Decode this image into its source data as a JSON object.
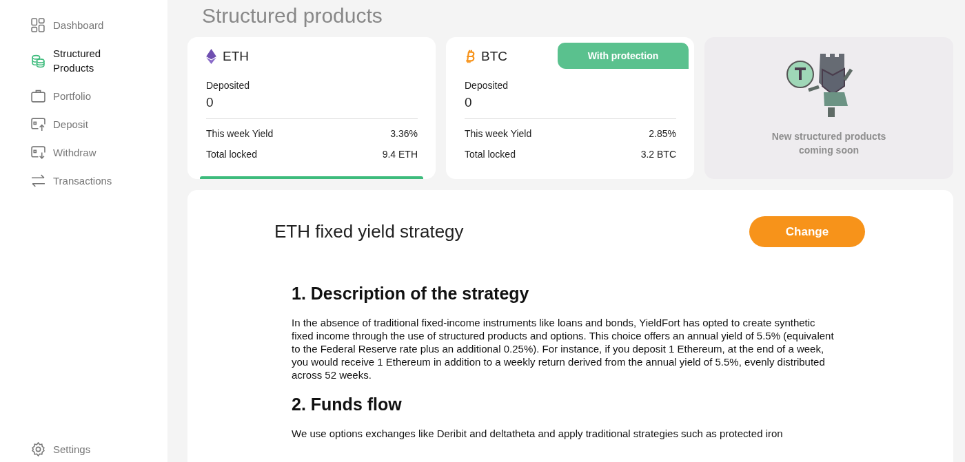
{
  "sidebar": {
    "items": [
      {
        "label": "Dashboard",
        "selected": false
      },
      {
        "label": "Structured\nProducts",
        "selected": true
      },
      {
        "label": "Portfolio",
        "selected": false
      },
      {
        "label": "Deposit",
        "selected": false
      },
      {
        "label": "Withdraw",
        "selected": false
      },
      {
        "label": "Transactions",
        "selected": false
      }
    ],
    "footer": {
      "label": "Settings"
    }
  },
  "page_title": "Structured products",
  "products": [
    {
      "kind": "eth",
      "name": "ETH",
      "selected": true,
      "deposited_label": "Deposited",
      "deposited": "0",
      "rows": [
        {
          "label": "This week Yield",
          "value": "3.36%"
        },
        {
          "label": "Total locked",
          "value": "9.4 ETH"
        }
      ]
    },
    {
      "kind": "btc",
      "name": "BTC",
      "selected": false,
      "tag": "With protection",
      "deposited_label": "Deposited",
      "deposited": "0",
      "rows": [
        {
          "label": "This week Yield",
          "value": "2.85%"
        },
        {
          "label": "Total locked",
          "value": "3.2 BTC"
        }
      ]
    }
  ],
  "coming_soon": "New structured products coming soon",
  "strategy": {
    "title": "ETH fixed yield strategy",
    "button": "Change",
    "sections": [
      {
        "heading": "1. Description of the strategy",
        "text": "In the absence of traditional fixed-income instruments like loans and bonds, YieldFort has opted to create synthetic fixed income through the use of structured products and options. This choice offers an annual yield of 5.5% (equivalent to the Federal Reserve rate plus an additional 0.25%). For instance, if you deposit 1 Ethereum, at the end of a week, you would receive 1 Ethereum in addition to a weekly return derived from the annual yield of 5.5%, evenly distributed across 52 weeks."
      },
      {
        "heading": "2. Funds flow",
        "text": "We use options exchanges like Deribit and deltatheta and apply traditional strategies such as protected iron"
      }
    ]
  }
}
